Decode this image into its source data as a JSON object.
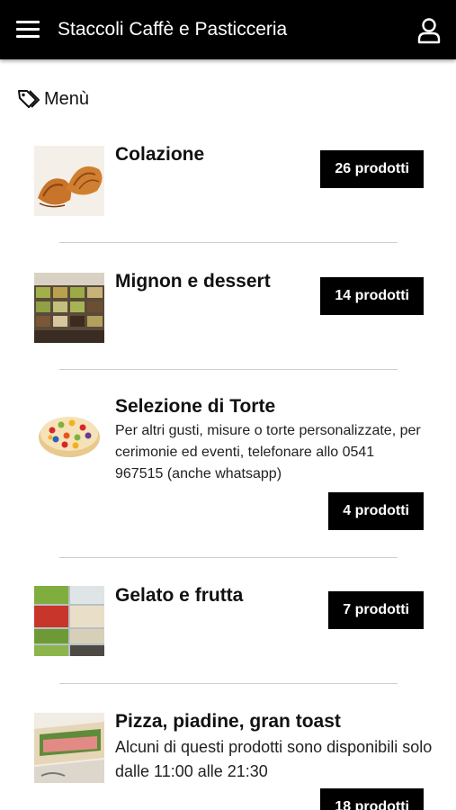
{
  "header": {
    "title": "Staccoli Caffè e Pasticceria",
    "menu_icon": "hamburger-menu-icon",
    "account_icon": "user-icon",
    "background": "#000000"
  },
  "section": {
    "icon": "tag-icon",
    "title": "Menù"
  },
  "categories": [
    {
      "name": "Colazione",
      "description": "",
      "count": "26 prodotti"
    },
    {
      "name": "Mignon e dessert",
      "description": "",
      "count": "14 prodotti"
    },
    {
      "name": "Selezione di Torte",
      "description": "Per altri gusti, misure o torte personalizzate, per cerimonie ed eventi, telefonare allo 0541 967515 (anche whatsapp)",
      "count": "4 prodotti"
    },
    {
      "name": "Gelato e frutta",
      "description": "",
      "count": "7 prodotti"
    },
    {
      "name": "Pizza, piadine, gran toast",
      "description": "Alcuni di questi prodotti sono disponibili solo dalle 11:00 alle 21:30",
      "count": "18 prodotti"
    }
  ],
  "colors": {
    "button_bg": "#000000",
    "button_text": "#ffffff",
    "divider": "#cfcfcf"
  }
}
